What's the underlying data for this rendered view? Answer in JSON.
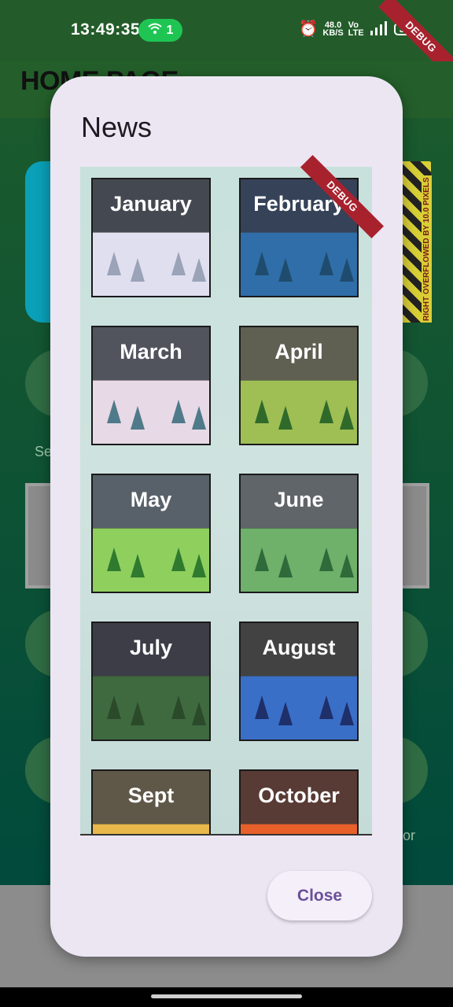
{
  "status_bar": {
    "time": "13:49:35",
    "wifi_count": "1",
    "net_speed_value": "48.0",
    "net_speed_unit": "KB/S",
    "battery": "30"
  },
  "app_bar": {
    "title": "HOME PAGE"
  },
  "debug_label": "DEBUG",
  "overflow_warning": "RIGHT OVERFLOWED BY 10.0 PIXELS",
  "background": {
    "left_text": "Se",
    "right_text": "or"
  },
  "dialog": {
    "title": "News",
    "close_label": "Close",
    "months": [
      {
        "label": "January",
        "sky": "#4f5a6a",
        "land": "#dfdff0",
        "tree": "#9aa3b8"
      },
      {
        "label": "February",
        "sky": "#2f4a7a",
        "land": "#2f6ea8",
        "tree": "#1f4c6e"
      },
      {
        "label": "March",
        "sky": "#6a6f86",
        "land": "#e8d9e6",
        "tree": "#4f7a8a"
      },
      {
        "label": "April",
        "sky": "#8a8a6e",
        "land": "#9fbf55",
        "tree": "#2f6a2a"
      },
      {
        "label": "May",
        "sky": "#7a8ea0",
        "land": "#8fcf5e",
        "tree": "#2f7a2f"
      },
      {
        "label": "June",
        "sky": "#8c97a2",
        "land": "#6fb06a",
        "tree": "#2f6a3a"
      },
      {
        "label": "July",
        "sky": "#3f3f58",
        "land": "#3f6a3f",
        "tree": "#2a4a2a"
      },
      {
        "label": "August",
        "sky": "#4a4a4a",
        "land": "#3a6fc8",
        "tree": "#1f2f6a"
      },
      {
        "label": "Sept",
        "sky": "#8a7a5a",
        "land": "#e8b84a",
        "tree": "#c07a2a"
      },
      {
        "label": "October",
        "sky": "#7a3a2a",
        "land": "#e8602a",
        "tree": "#8a2a1a"
      }
    ]
  }
}
